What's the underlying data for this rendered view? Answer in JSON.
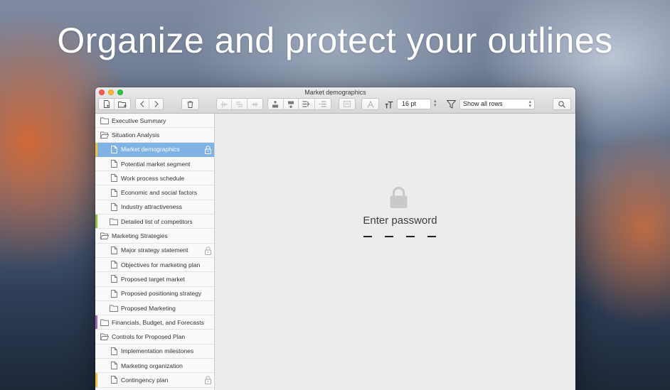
{
  "headline": "Organize and protect your outlines",
  "window": {
    "title": "Market demographics",
    "font_size": "16 pt",
    "filter": "Show all rows"
  },
  "toolbar_icons": [
    "new-document-icon",
    "new-folder-icon",
    "back-icon",
    "forward-icon",
    "trash-icon",
    "indent-icon",
    "outdent-icon",
    "move-icon",
    "move-up-icon",
    "move-down-icon",
    "align-icon",
    "list-icon",
    "note-icon",
    "text-color-icon",
    "font-size-icon",
    "filter-icon",
    "search-icon"
  ],
  "sidebar": {
    "items": [
      {
        "label": "Executive Summary",
        "type": "folder",
        "level": 0,
        "mark": "",
        "lock": false,
        "selected": false
      },
      {
        "label": "Situation Analysis",
        "type": "folder-open",
        "level": 0,
        "mark": "",
        "lock": false,
        "selected": false
      },
      {
        "label": "Market demographics",
        "type": "doc",
        "level": 1,
        "mark": "#f3c43f",
        "lock": true,
        "selected": true
      },
      {
        "label": "Potential market segment",
        "type": "doc",
        "level": 1,
        "mark": "",
        "lock": false,
        "selected": false
      },
      {
        "label": "Work process schedule",
        "type": "doc",
        "level": 1,
        "mark": "",
        "lock": false,
        "selected": false
      },
      {
        "label": "Economic and social factors",
        "type": "doc",
        "level": 1,
        "mark": "",
        "lock": false,
        "selected": false
      },
      {
        "label": "Industry attractiveness",
        "type": "doc",
        "level": 1,
        "mark": "",
        "lock": false,
        "selected": false
      },
      {
        "label": "Detailed list of competitors",
        "type": "folder",
        "level": 1,
        "mark": "#8cc63e",
        "lock": false,
        "selected": false
      },
      {
        "label": "Marketing Strategies",
        "type": "folder-open",
        "level": 0,
        "mark": "",
        "lock": false,
        "selected": false
      },
      {
        "label": "Major strategy statement",
        "type": "doc",
        "level": 1,
        "mark": "",
        "lock": true,
        "selected": false
      },
      {
        "label": "Objectives for marketing plan",
        "type": "doc",
        "level": 1,
        "mark": "",
        "lock": false,
        "selected": false
      },
      {
        "label": "Proposed target market",
        "type": "doc",
        "level": 1,
        "mark": "",
        "lock": false,
        "selected": false
      },
      {
        "label": "Proposed positioning strategy",
        "type": "doc",
        "level": 1,
        "mark": "",
        "lock": false,
        "selected": false
      },
      {
        "label": "Proposed Marketing",
        "type": "folder",
        "level": 1,
        "mark": "",
        "lock": false,
        "selected": false
      },
      {
        "label": "Financials, Budget, and Forecasts",
        "type": "folder",
        "level": 0,
        "mark": "#a566c4",
        "lock": false,
        "selected": false
      },
      {
        "label": "Controls for Proposed Plan",
        "type": "folder-open",
        "level": 0,
        "mark": "",
        "lock": false,
        "selected": false
      },
      {
        "label": "Implementation milestones",
        "type": "doc",
        "level": 1,
        "mark": "",
        "lock": false,
        "selected": false
      },
      {
        "label": "Marketing organization",
        "type": "doc",
        "level": 1,
        "mark": "",
        "lock": false,
        "selected": false
      },
      {
        "label": "Contingency plan",
        "type": "doc",
        "level": 1,
        "mark": "#f3c43f",
        "lock": true,
        "selected": false
      }
    ]
  },
  "password": {
    "title": "Enter password",
    "digits": 4
  },
  "colors": {
    "selected_row": "#7fb2e5",
    "yellow_mark": "#f3c43f",
    "green_mark": "#8cc63e",
    "purple_mark": "#a566c4"
  }
}
